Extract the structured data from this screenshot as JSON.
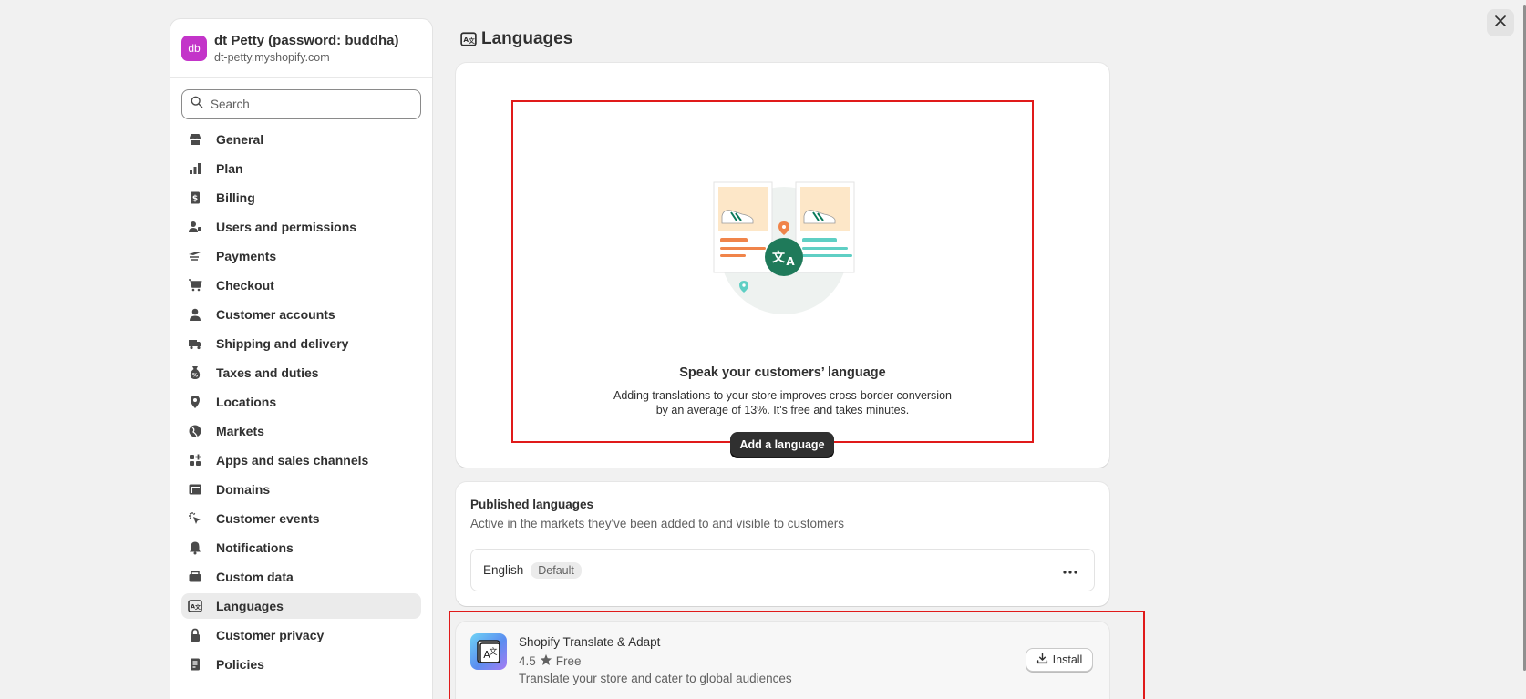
{
  "store": {
    "avatar_initials": "db",
    "name": "dt Petty (password: buddha)",
    "url": "dt-petty.myshopify.com"
  },
  "search": {
    "placeholder": "Search",
    "value": ""
  },
  "sidebar": {
    "items": [
      {
        "label": "General",
        "icon": "store-icon"
      },
      {
        "label": "Plan",
        "icon": "plan-icon"
      },
      {
        "label": "Billing",
        "icon": "billing-icon"
      },
      {
        "label": "Users and permissions",
        "icon": "users-icon"
      },
      {
        "label": "Payments",
        "icon": "payments-icon"
      },
      {
        "label": "Checkout",
        "icon": "cart-icon"
      },
      {
        "label": "Customer accounts",
        "icon": "person-icon"
      },
      {
        "label": "Shipping and delivery",
        "icon": "truck-icon"
      },
      {
        "label": "Taxes and duties",
        "icon": "tax-icon"
      },
      {
        "label": "Locations",
        "icon": "location-icon"
      },
      {
        "label": "Markets",
        "icon": "globe-icon"
      },
      {
        "label": "Apps and sales channels",
        "icon": "apps-icon"
      },
      {
        "label": "Domains",
        "icon": "domains-icon"
      },
      {
        "label": "Customer events",
        "icon": "events-icon"
      },
      {
        "label": "Notifications",
        "icon": "bell-icon"
      },
      {
        "label": "Custom data",
        "icon": "custom-data-icon"
      },
      {
        "label": "Languages",
        "icon": "language-icon",
        "active": true
      },
      {
        "label": "Customer privacy",
        "icon": "lock-icon"
      },
      {
        "label": "Policies",
        "icon": "policies-icon"
      }
    ]
  },
  "page": {
    "title": "Languages",
    "title_icon": "language-icon"
  },
  "hero": {
    "title": "Speak your customers’ language",
    "description_line1": "Adding translations to your store improves cross-border conversion",
    "description_line2": "by an average of 13%. It's free and takes minutes.",
    "button_label": "Add a language"
  },
  "published": {
    "title": "Published languages",
    "subtitle": "Active in the markets they've been added to and visible to customers",
    "languages": [
      {
        "name": "English",
        "badge": "Default"
      }
    ]
  },
  "app": {
    "name": "Shopify Translate & Adapt",
    "rating": "4.5",
    "price": "Free",
    "description": "Translate your store and cater to global audiences",
    "install_label": "Install"
  },
  "colors": {
    "background": "#f1f1f1",
    "avatar": "#c334c9",
    "primary_button": "#303030",
    "highlight_frame": "#e01a1a",
    "translate_badge": "#1f7a5a"
  }
}
